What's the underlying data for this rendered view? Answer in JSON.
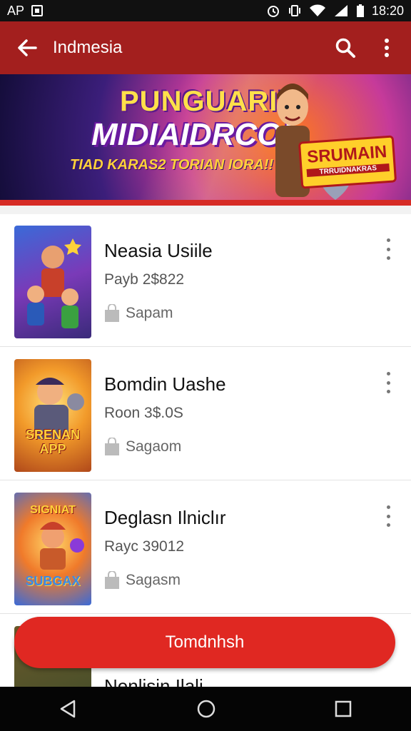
{
  "status_bar": {
    "left_text": "AP",
    "time": "18:20"
  },
  "app_bar": {
    "title": "Indmesia",
    "back_icon": "arrow-left-icon",
    "search_icon": "search-icon",
    "menu_icon": "more-vert-icon"
  },
  "banner": {
    "line1": "PUNGUARII",
    "line2": "MIDIAIDRCO!",
    "line3": "TIAD KARAS2 TORIAN IORA!!",
    "badge_title": "SRUMAIN",
    "badge_sub": "TRRUIDNAKRAS"
  },
  "games": [
    {
      "title": "Neasia Usiile",
      "price": "Payb 2$822",
      "tag": "Sapam"
    },
    {
      "title": "Bomdin Uashe",
      "price": "Roon 3$.0S",
      "tag": "Sagaom",
      "thumb_text": "SRENAN APP"
    },
    {
      "title": "Deglasn Ilniclır",
      "price": "Rayc 39012",
      "tag": "Sagasm",
      "thumb_text_top": "SIGNIAT",
      "thumb_text_bottom": "SUBGAX"
    },
    {
      "title": "Nenlisin Ilali"
    }
  ],
  "fab": {
    "label": "Tomdnhsh"
  },
  "colors": {
    "app_bar": "#a31f1e",
    "accent": "#e02822",
    "stripe": "#d62b25"
  }
}
